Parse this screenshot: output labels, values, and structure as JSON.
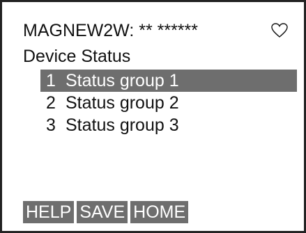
{
  "header": {
    "device_tag": "MAGNEW2W: ** ******",
    "icon": "heart-icon"
  },
  "page": {
    "title": "Device Status"
  },
  "menu": {
    "items": [
      {
        "number": "1",
        "label": "Status group 1",
        "selected": true
      },
      {
        "number": "2",
        "label": "Status group 2",
        "selected": false
      },
      {
        "number": "3",
        "label": "Status group 3",
        "selected": false
      }
    ]
  },
  "softkeys": {
    "help": "HELP",
    "save": "SAVE",
    "home": "HOME"
  },
  "colors": {
    "highlight": "#6e6e6e",
    "text": "#111111",
    "background": "#ffffff"
  }
}
